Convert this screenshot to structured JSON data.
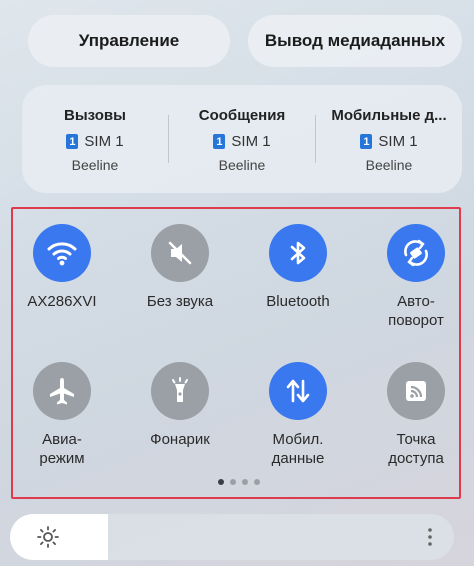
{
  "top_buttons": {
    "control": "Управление",
    "media_output": "Вывод медиаданных"
  },
  "sim_panel": {
    "columns": [
      {
        "title": "Вызовы",
        "sim": "SIM 1",
        "carrier": "Beeline"
      },
      {
        "title": "Сообщения",
        "sim": "SIM 1",
        "carrier": "Beeline"
      },
      {
        "title": "Мобильные д...",
        "sim": "SIM 1",
        "carrier": "Beeline"
      }
    ],
    "sim_badge": "1",
    "badge_color": "#2676d9"
  },
  "tiles": [
    {
      "label": "AX286XVI",
      "label2": "",
      "icon": "wifi-icon",
      "state": "on"
    },
    {
      "label": "Без звука",
      "label2": "",
      "icon": "mute-icon",
      "state": "off"
    },
    {
      "label": "Bluetooth",
      "label2": "",
      "icon": "bluetooth-icon",
      "state": "on"
    },
    {
      "label": "Авто-",
      "label2": "поворот",
      "icon": "auto-rotate-icon",
      "state": "on"
    },
    {
      "label": "Авиа-",
      "label2": "режим",
      "icon": "airplane-icon",
      "state": "off"
    },
    {
      "label": "Фонарик",
      "label2": "",
      "icon": "flashlight-icon",
      "state": "off"
    },
    {
      "label": "Мобил.",
      "label2": "данные",
      "icon": "mobile-data-icon",
      "state": "on"
    },
    {
      "label": "Точка",
      "label2": "доступа",
      "icon": "hotspot-icon",
      "state": "off"
    }
  ],
  "pagination": {
    "pages": 4,
    "current": 1
  },
  "brightness": {
    "level": 0.22
  },
  "colors": {
    "active": "#3a78ef",
    "inactive": "#9aa0a5",
    "highlight": "#e03a4d"
  }
}
